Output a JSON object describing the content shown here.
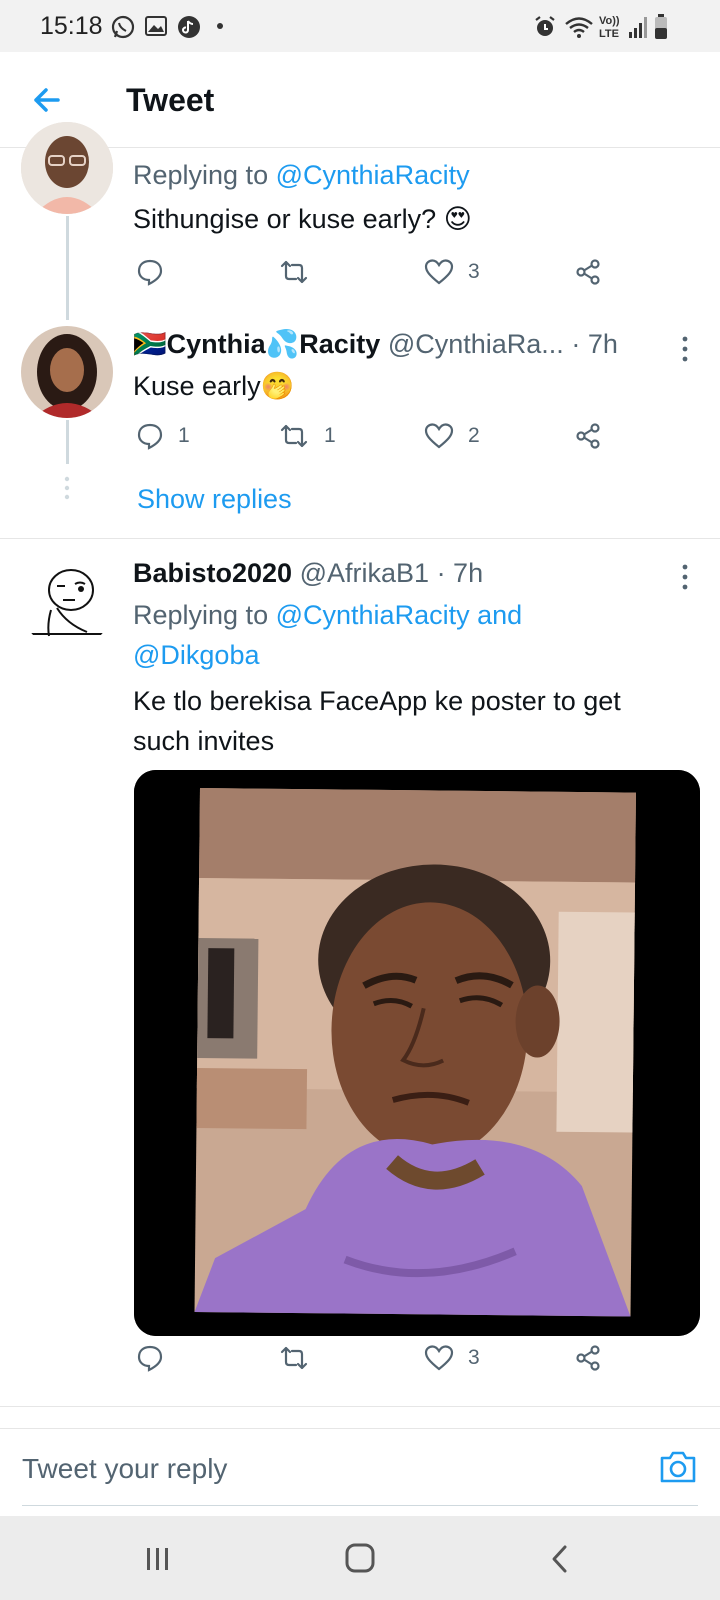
{
  "status_bar": {
    "time": "15:18",
    "left_icons": [
      "whatsapp-icon",
      "gallery-icon",
      "tiktok-icon",
      "dot-icon"
    ],
    "right_icons": [
      "alarm-icon",
      "wifi-icon",
      "volte-icon",
      "signal-icon",
      "battery-icon"
    ],
    "volte_label": "Vo)) LTE"
  },
  "header": {
    "title": "Tweet",
    "back_icon": "arrow-left-icon"
  },
  "tweets": [
    {
      "replying_prefix": "Replying to",
      "replying_to": "@CynthiaRacity",
      "text": "Sithungise or kuse early?",
      "emoji": "😍",
      "replies": "",
      "retweets": "",
      "likes": "3"
    },
    {
      "flag": "🇿🇦",
      "name_part1": "Cynthia",
      "name_emoji": "💦",
      "name_part2": "Racity",
      "handle": "@CynthiaRa...",
      "time": "· 7h",
      "text": "Kuse early",
      "emoji": "🤭",
      "replies": "1",
      "retweets": "1",
      "likes": "2",
      "show_replies": "Show replies"
    },
    {
      "name": "Babisto2020",
      "handle": "@AfrikaB1",
      "time": "· 7h",
      "replying_prefix": "Replying to",
      "replying_line1": "@CynthiaRacity and",
      "replying_line2": "@Dikgoba",
      "text_line1": "Ke tlo berekisa FaceApp ke poster to get",
      "text_line2": "such invites",
      "replies": "",
      "retweets": "",
      "likes": "3"
    }
  ],
  "reply_bar": {
    "placeholder": "Tweet your reply",
    "camera_icon": "camera-icon"
  },
  "colors": {
    "accent": "#1d9bf0",
    "secondary_text": "#536471",
    "primary_text": "#0f1419",
    "divider": "#e6e6e6"
  },
  "nav_bar": {
    "icons": [
      "recents-icon",
      "home-icon",
      "back-icon"
    ]
  }
}
